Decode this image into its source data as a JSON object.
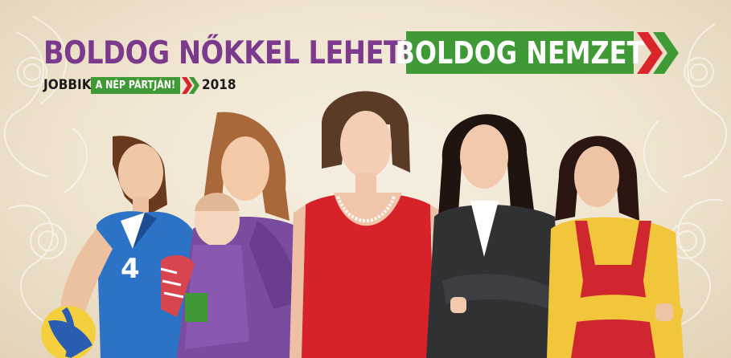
{
  "headline": {
    "purple_text": "BOLDOG NŐKKEL LEHETÜNK",
    "green_text": "BOLDOG NEMZET"
  },
  "subline": {
    "party": "JOBBIK",
    "slogan": "A NÉP PÁRTJÁN!",
    "year": "2018"
  },
  "jersey_number": "4",
  "colors": {
    "purple": "#7b3a8c",
    "green": "#3f9a36",
    "red": "#d9262b",
    "background": "#f2e8d6"
  }
}
